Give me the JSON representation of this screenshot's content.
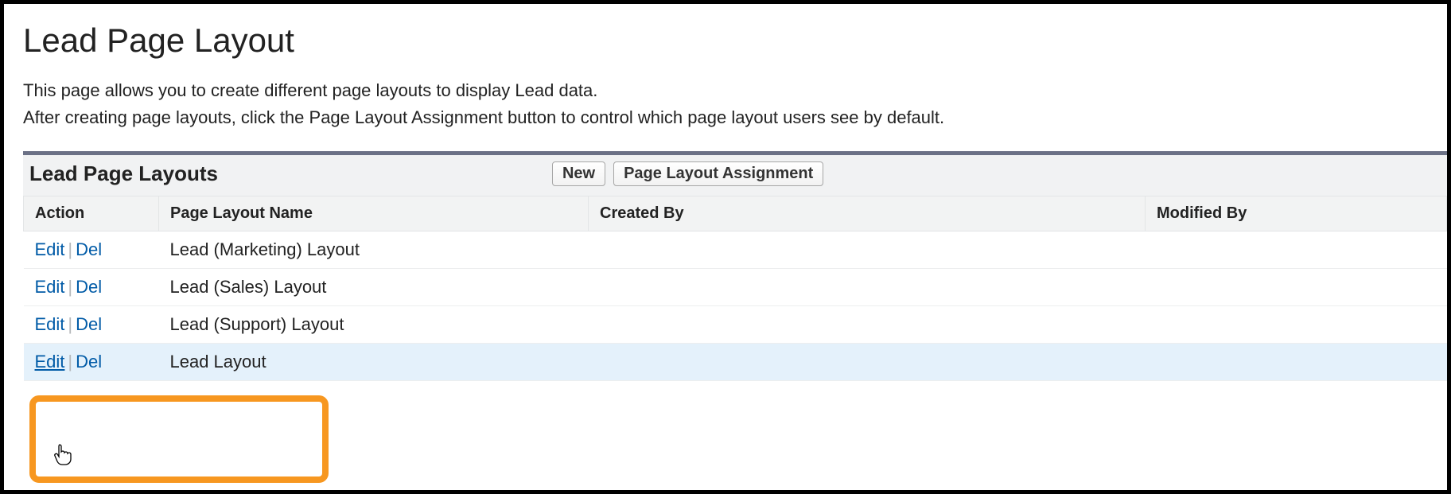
{
  "page": {
    "title": "Lead Page Layout",
    "desc1": "This page allows you to create different page layouts to display Lead data.",
    "desc2": "After creating page layouts, click the Page Layout Assignment button to control which page layout users see by default."
  },
  "panel": {
    "title": "Lead Page Layouts",
    "new_btn": "New",
    "assign_btn": "Page Layout Assignment"
  },
  "table": {
    "headers": {
      "action": "Action",
      "name": "Page Layout Name",
      "created": "Created By",
      "modified": "Modified By"
    },
    "action_labels": {
      "edit": "Edit",
      "del": "Del"
    },
    "rows": [
      {
        "name": "Lead (Marketing) Layout",
        "created": "",
        "modified": ""
      },
      {
        "name": "Lead (Sales) Layout",
        "created": "",
        "modified": ""
      },
      {
        "name": "Lead (Support) Layout",
        "created": "",
        "modified": ""
      },
      {
        "name": "Lead Layout",
        "created": "",
        "modified": ""
      }
    ]
  }
}
